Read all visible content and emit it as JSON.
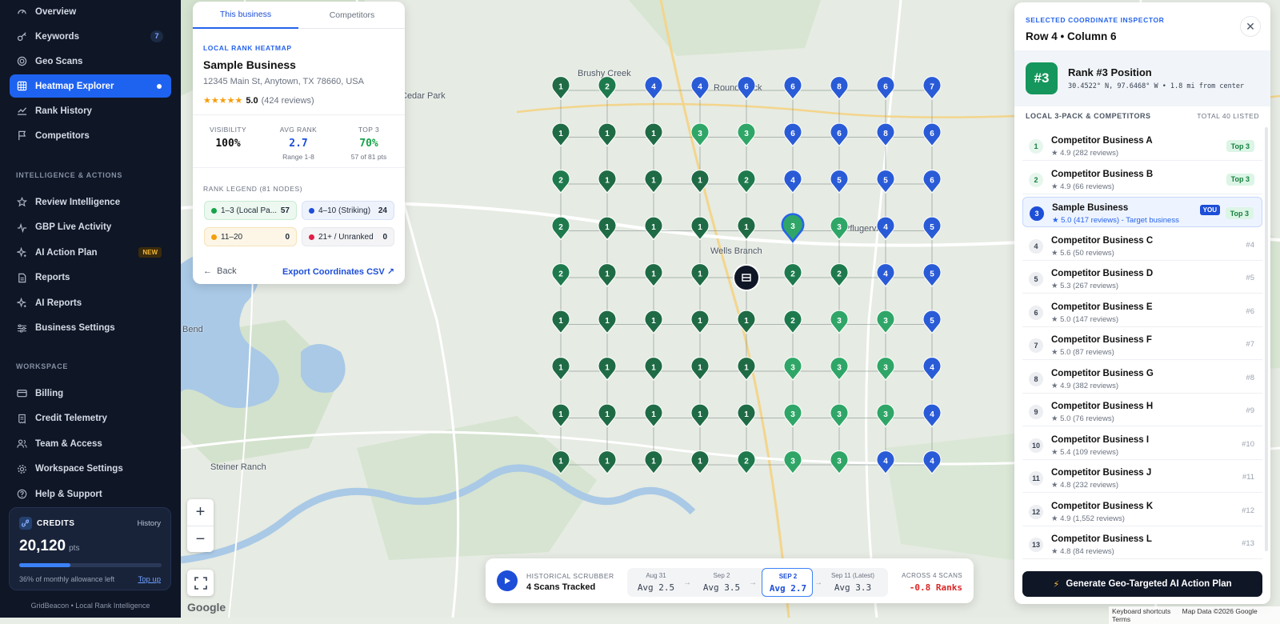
{
  "sidebar": {
    "items": [
      {
        "label": "Overview",
        "icon": "gauge-icon"
      },
      {
        "label": "Keywords",
        "icon": "key-icon",
        "badge": "7"
      },
      {
        "label": "Geo Scans",
        "icon": "radar-icon"
      },
      {
        "label": "Heatmap Explorer",
        "icon": "grid-icon",
        "active": true
      },
      {
        "label": "Rank History",
        "icon": "trend-icon"
      },
      {
        "label": "Competitors",
        "icon": "flag-icon"
      }
    ],
    "section_intel": "INTELLIGENCE & ACTIONS",
    "intel_items": [
      {
        "label": "Review Intelligence",
        "icon": "star-icon"
      },
      {
        "label": "GBP Live Activity",
        "icon": "pulse-icon"
      },
      {
        "label": "AI Action Plan",
        "icon": "sparkle-icon",
        "badge": "NEW"
      },
      {
        "label": "Reports",
        "icon": "file-icon"
      },
      {
        "label": "AI Reports",
        "icon": "sparkle-icon"
      },
      {
        "label": "Business Settings",
        "icon": "sliders-icon"
      }
    ],
    "section_workspace": "WORKSPACE",
    "workspace_items": [
      {
        "label": "Billing",
        "icon": "card-icon"
      },
      {
        "label": "Credit Telemetry",
        "icon": "receipt-icon"
      },
      {
        "label": "Team & Access",
        "icon": "users-icon"
      },
      {
        "label": "Workspace Settings",
        "icon": "gear-icon"
      },
      {
        "label": "Help & Support",
        "icon": "help-icon"
      }
    ],
    "credits": {
      "title": "CREDITS",
      "history": "History",
      "value": "20,120",
      "unit": "pts",
      "used_fraction": 0.36,
      "note": "36% of monthly allowance left",
      "topup": "Top up"
    },
    "footer": "GridBeacon  •  Local Rank Intelligence"
  },
  "map": {
    "places": [
      "Brushy Creek",
      "Round Rock",
      "Cedar Park",
      "Pflugerville",
      "Wells Branch",
      "Bend",
      "Steiner Ranch"
    ],
    "grid": [
      [
        1,
        2,
        4,
        4,
        6,
        6,
        8,
        6,
        7
      ],
      [
        1,
        1,
        1,
        3,
        3,
        6,
        6,
        8,
        6
      ],
      [
        2,
        1,
        1,
        1,
        2,
        4,
        5,
        5,
        6
      ],
      [
        2,
        1,
        1,
        1,
        1,
        3,
        3,
        4,
        5
      ],
      [
        2,
        1,
        1,
        1,
        0,
        2,
        2,
        4,
        5
      ],
      [
        1,
        1,
        1,
        1,
        1,
        2,
        3,
        3,
        5
      ],
      [
        1,
        1,
        1,
        1,
        1,
        3,
        3,
        3,
        4
      ],
      [
        1,
        1,
        1,
        1,
        1,
        3,
        3,
        3,
        4
      ],
      [
        1,
        1,
        1,
        1,
        2,
        3,
        3,
        4,
        4
      ]
    ],
    "selected": {
      "row": 4,
      "col": 6
    },
    "colors": {
      "dark_green": "#1f6b45",
      "green": "#2fa667",
      "blue": "#2a5bd7",
      "line": "#7a8a86"
    }
  },
  "biz": {
    "tabs": [
      "This business",
      "Competitors"
    ],
    "kicker": "LOCAL RANK HEATMAP",
    "name": "Sample Business",
    "address": "12345 Main St, Anytown, TX 78660, USA",
    "stars": "★★★★★",
    "rating": "5.0",
    "reviews": "(424 reviews)",
    "stats": [
      {
        "label": "VISIBILITY",
        "value": "100%",
        "sub": ""
      },
      {
        "label": "AVG RANK",
        "value": "2.7",
        "sub": "Range 1-8"
      },
      {
        "label": "TOP 3",
        "value": "70%",
        "sub": "57 of 81 pts"
      }
    ],
    "legend_title": "RANK LEGEND (81 NODES)",
    "legend": [
      {
        "label": "1–3 (Local Pa...",
        "count": "57",
        "color": "#16a34a",
        "bg": "#ecf8f0",
        "border": "#c9ebd4"
      },
      {
        "label": "4–10 (Striking)",
        "count": "24",
        "color": "#1d4ed8",
        "bg": "#eef2fb",
        "border": "#d6e0f7"
      },
      {
        "label": "11–20",
        "count": "0",
        "color": "#f59e0b",
        "bg": "#fdf6e7",
        "border": "#f5e2b8"
      },
      {
        "label": "21+ / Unranked",
        "count": "0",
        "color": "#e11d48",
        "bg": "#f4f4f6",
        "border": "#e5e7eb"
      }
    ],
    "back": "Back",
    "export": "Export Coordinates CSV"
  },
  "inspector": {
    "kicker": "SELECTED COORDINATE INSPECTOR",
    "title": "Row 4 • Column 6",
    "badge": "#3",
    "rank_title": "Rank #3 Position",
    "coords": "30.4522° N, 97.6468° W • 1.8 mi from center",
    "section": "LOCAL 3-PACK & COMPETITORS",
    "total": "TOTAL 40 LISTED",
    "you_label": "YOU",
    "competitors": [
      {
        "rank": "1",
        "name": "Competitor Business A",
        "rating": "★ 4.9 (282 reviews)",
        "tag": "Top 3"
      },
      {
        "rank": "2",
        "name": "Competitor Business B",
        "rating": "★ 4.9 (66 reviews)",
        "tag": "Top 3"
      },
      {
        "rank": "3",
        "name": "Sample Business",
        "rating": "★ 5.0 (417 reviews) - Target business",
        "tag": "Top 3",
        "you": true
      },
      {
        "rank": "4",
        "name": "Competitor Business C",
        "rating": "★ 5.6 (50 reviews)",
        "pos": "#4"
      },
      {
        "rank": "5",
        "name": "Competitor Business D",
        "rating": "★ 5.3 (267 reviews)",
        "pos": "#5"
      },
      {
        "rank": "6",
        "name": "Competitor Business E",
        "rating": "★ 5.0 (147 reviews)",
        "pos": "#6"
      },
      {
        "rank": "7",
        "name": "Competitor Business F",
        "rating": "★ 5.0 (87 reviews)",
        "pos": "#7"
      },
      {
        "rank": "8",
        "name": "Competitor Business G",
        "rating": "★ 4.9 (382 reviews)",
        "pos": "#8"
      },
      {
        "rank": "9",
        "name": "Competitor Business H",
        "rating": "★ 5.0 (76 reviews)",
        "pos": "#9"
      },
      {
        "rank": "10",
        "name": "Competitor Business I",
        "rating": "★ 5.4 (109 reviews)",
        "pos": "#10"
      },
      {
        "rank": "11",
        "name": "Competitor Business J",
        "rating": "★ 4.8 (232 reviews)",
        "pos": "#11"
      },
      {
        "rank": "12",
        "name": "Competitor Business K",
        "rating": "★ 4.9 (1,552 reviews)",
        "pos": "#12"
      },
      {
        "rank": "13",
        "name": "Competitor Business L",
        "rating": "★ 4.8 (84 reviews)",
        "pos": "#13"
      }
    ],
    "cta": "Generate Geo-Targeted AI Action Plan"
  },
  "scrubber": {
    "kicker": "HISTORICAL SCRUBBER",
    "title": "4 Scans Tracked",
    "steps": [
      {
        "date": "Aug 31",
        "avg": "Avg 2.5"
      },
      {
        "date": "Sep 2",
        "avg": "Avg 3.5"
      },
      {
        "date": "SEP 2",
        "avg": "Avg 2.7",
        "current": true
      },
      {
        "date": "Sep 11 (Latest)",
        "avg": "Avg 3.3"
      }
    ],
    "across": "ACROSS 4 SCANS",
    "delta": "-0.8 Ranks"
  },
  "attribution": {
    "google": "Google",
    "shortcuts": "Keyboard shortcuts",
    "mapdata": "Map Data ©2026 Google",
    "terms": "Terms"
  }
}
